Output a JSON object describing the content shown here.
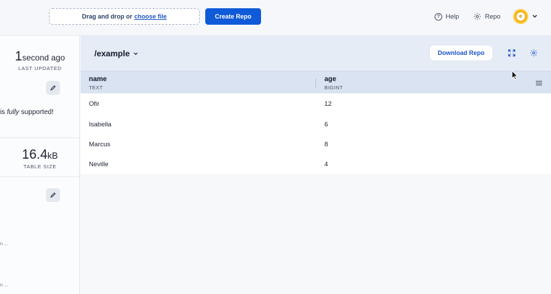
{
  "topbar": {
    "dropzone_text": "Drag and drop or",
    "dropzone_link": "choose file",
    "create_label": "Create Repo",
    "help_label": "Help",
    "repo_label": "Repo"
  },
  "sidebar": {
    "updated_number": "1",
    "updated_unit": "second ago",
    "updated_label": "LAST UPDATED",
    "desc_prefix": "is",
    "desc_emph": "fully",
    "desc_suffix": "supported!",
    "size_number": "16.4",
    "size_unit": "kB",
    "size_label": "TABLE SIZE",
    "truncated_1": "n ...",
    "truncated_2": "n ..."
  },
  "main": {
    "repo_title": "/example",
    "download_label": "Download Repo"
  },
  "table": {
    "columns": [
      {
        "name": "name",
        "type": "TEXT"
      },
      {
        "name": "age",
        "type": "BIGINT"
      }
    ],
    "rows": [
      [
        "Ofir",
        "12"
      ],
      [
        "Isabella",
        "6"
      ],
      [
        "Marcus",
        "8"
      ],
      [
        "Neville",
        "4"
      ]
    ]
  },
  "colors": {
    "accent": "#0f5ad8",
    "header_bg": "#e6ecf6",
    "table_head_bg": "#dae3f1",
    "avatar": "#f4b41a"
  },
  "icons": [
    "help-icon",
    "gear-icon",
    "avatar",
    "chevron-down-icon",
    "pencil-icon",
    "expand-icon",
    "settings-icon",
    "menu-icon"
  ]
}
